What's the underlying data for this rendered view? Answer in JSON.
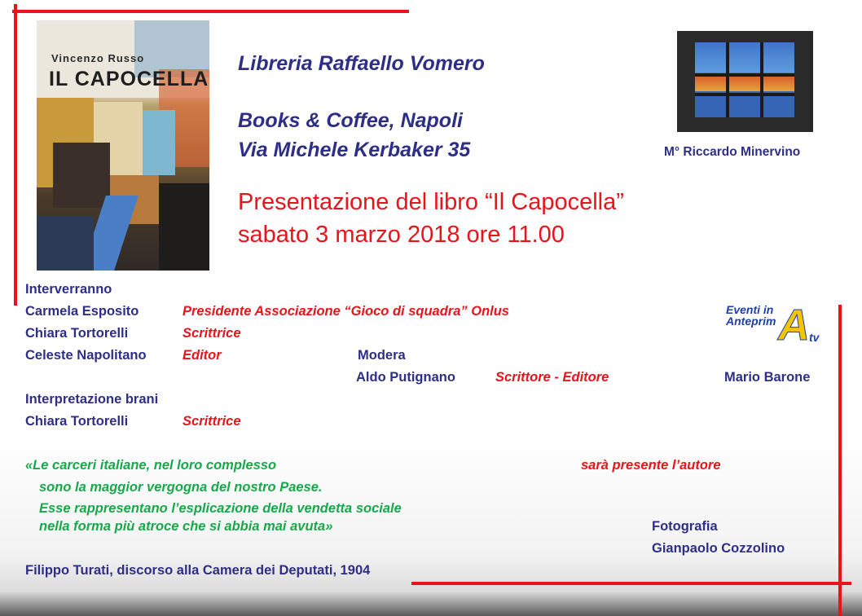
{
  "venue": {
    "line1": "Libreria Raffaello Vomero",
    "line2": "Books & Coffee, Napoli",
    "line3": "Via Michele Kerbaker 35"
  },
  "painting_caption": "M° Riccardo Minervino",
  "presentation": {
    "line1": "Presentazione  del libro “Il Capocella”",
    "line2": "sabato 3 marzo 2018 ore 11.00"
  },
  "book_cover": {
    "author": "Vincenzo Russo",
    "title": "IL CAPOCELLA"
  },
  "logo": {
    "line1": "Eventi in",
    "line2": "Anteprim",
    "letter": "A",
    "suffix": "tv"
  },
  "speakers_heading": "Interverranno",
  "speakers": [
    {
      "name": "Carmela Esposito",
      "role": "Presidente Associazione “Gioco di squadra” Onlus"
    },
    {
      "name": "Chiara Tortorelli",
      "role": "Scrittrice"
    },
    {
      "name": "Celeste Napolitano",
      "role": "Editor"
    }
  ],
  "moderator": {
    "heading": "Modera",
    "name": "Aldo Putignano",
    "role": "Scrittore - Editore"
  },
  "extra_name": "Mario Barone",
  "readings": {
    "heading": "Interpretazione brani",
    "name": "Chiara Tortorelli",
    "role": "Scrittrice"
  },
  "quote": {
    "line1": "«Le carceri italiane, nel loro complesso",
    "line2": "sono la maggior vergogna del nostro Paese.",
    "line3": "Esse rappresentano l’esplicazione della vendetta sociale",
    "line4": "nella forma più atroce che si abbia mai avuta»",
    "attribution": "Filippo Turati, discorso alla Camera dei Deputati, 1904"
  },
  "author_note": "sarà presente l’autore",
  "photography": {
    "heading": "Fotografia",
    "name": "Gianpaolo Cozzolino"
  },
  "colors": {
    "navy": "#2e2e87",
    "red": "#e8141b",
    "green": "#17a84a"
  }
}
